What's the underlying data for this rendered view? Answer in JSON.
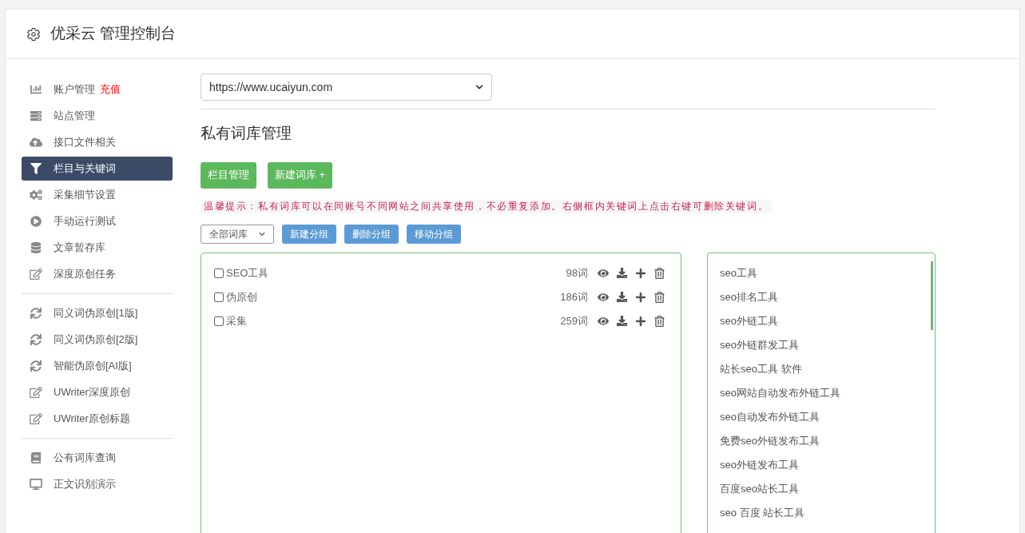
{
  "header": {
    "title": "优采云 管理控制台"
  },
  "sidebar": {
    "groups": [
      [
        {
          "label": "账户管理",
          "badge": "充值",
          "selected": false
        },
        {
          "label": "站点管理",
          "selected": false
        },
        {
          "label": "接口文件相关",
          "selected": false
        },
        {
          "label": "栏目与关键词",
          "selected": true
        },
        {
          "label": "采集细节设置",
          "selected": false
        },
        {
          "label": "手动运行测试",
          "selected": false
        },
        {
          "label": "文章暂存库",
          "selected": false
        },
        {
          "label": "深度原创任务",
          "selected": false
        }
      ],
      [
        {
          "label": "同义词伪原创[1版]",
          "selected": false
        },
        {
          "label": "同义词伪原创[2版]",
          "selected": false
        },
        {
          "label": "智能伪原创[AI版]",
          "selected": false
        },
        {
          "label": "UWriter深度原创",
          "selected": false
        },
        {
          "label": "UWriter原创标题",
          "selected": false
        }
      ],
      [
        {
          "label": "公有词库查询",
          "selected": false
        },
        {
          "label": "正文识别演示",
          "selected": false
        }
      ]
    ]
  },
  "site_select": {
    "value": "https://www.ucaiyun.com"
  },
  "section_title": "私有词库管理",
  "top_buttons": [
    "栏目管理",
    "新建词库 +"
  ],
  "hint": "温馨提示：私有词库可以在同账号不同网站之间共享使用，不必重复添加。右侧框内关键词上点击右键可删除关键词。",
  "group_select": {
    "value": "全部词库"
  },
  "group_buttons": [
    "新建分组",
    "删除分组",
    "移动分组"
  ],
  "libraries": [
    {
      "name": "SEO工具",
      "count": "98词",
      "checked": false
    },
    {
      "name": "伪原创",
      "count": "186词",
      "checked": false
    },
    {
      "name": "采集",
      "count": "259词",
      "checked": false
    }
  ],
  "keywords": [
    "seo工具",
    "seo排名工具",
    "seo外链工具",
    "seo外链群发工具",
    "站长seo工具 软件",
    "seo网站自动发布外链工具",
    "seo自动发布外链工具",
    "免费seo外链发布工具",
    "seo外链发布工具",
    "百度seo站长工具",
    "seo 百度 站长工具"
  ]
}
